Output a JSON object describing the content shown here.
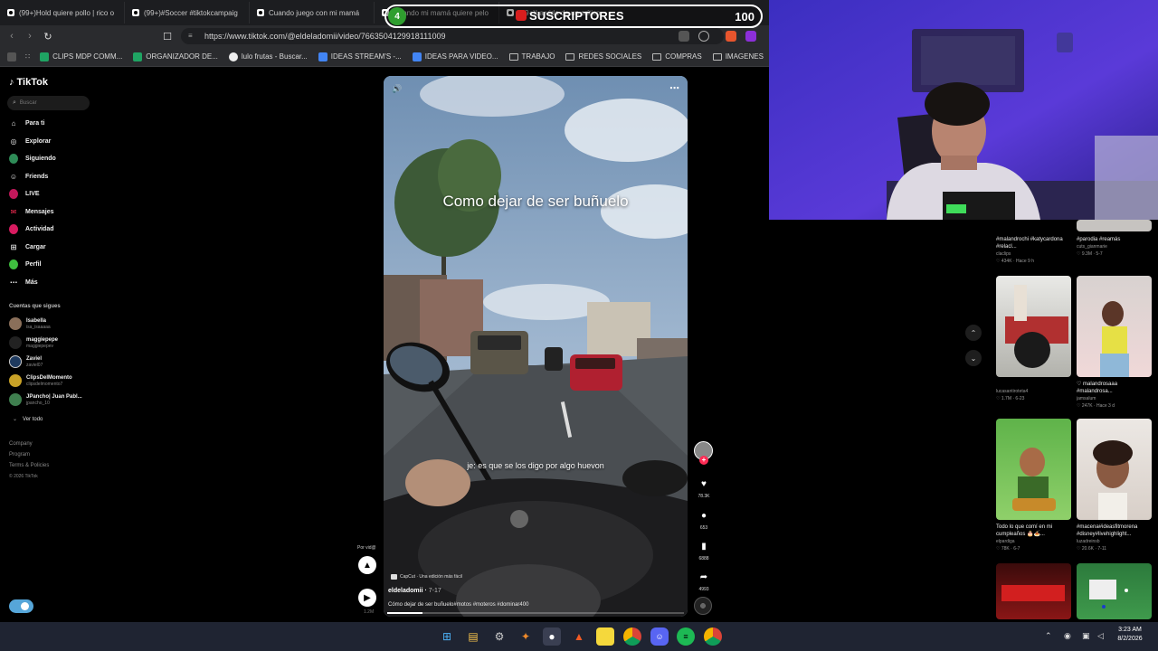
{
  "browser": {
    "tabs": [
      {
        "label": "(99+)Hold quiere pollo | rico o",
        "icon": "tiktok"
      },
      {
        "label": "(99+)#Soccer #tiktokcampaig",
        "icon": "tiktok"
      },
      {
        "label": "Cuando juego con mi mamá",
        "icon": "tiktok"
      },
      {
        "label": "Cuando mi mamá quiere pelo",
        "icon": "tiktok"
      },
      {
        "label": "(99+)La vida de un crítico",
        "icon": "tiktok"
      }
    ],
    "url": "https://www.tiktok.com/@eldeladomii/video/7663504129918111009",
    "bookmarks": [
      {
        "label": "CLIPS MDP COMM...",
        "color": "#1fa463"
      },
      {
        "label": "ORGANIZADOR DE...",
        "color": "#1fa463"
      },
      {
        "label": "lulo frutas - Buscar...",
        "color": "#e9e9e9"
      },
      {
        "label": "IDEAS STREAM'S -...",
        "color": "#4285f4"
      },
      {
        "label": "IDEAS PARA VIDEO...",
        "color": "#4285f4"
      },
      {
        "label": "TRABAJO",
        "color": "folder"
      },
      {
        "label": "REDES SOCIALES",
        "color": "folder"
      },
      {
        "label": "COMPRAS",
        "color": "folder"
      },
      {
        "label": "IMAGENES",
        "color": "folder"
      }
    ]
  },
  "overlay": {
    "subs_title": "SUSCRIPTORES",
    "subs_left": "4",
    "subs_right": "100"
  },
  "tiktok": {
    "logo": "TikTok",
    "search_placeholder": "Buscar",
    "nav": [
      {
        "label": "Para ti",
        "icon": "home-icon"
      },
      {
        "label": "Explorar",
        "icon": "compass-icon"
      },
      {
        "label": "Siguiendo",
        "icon": "following-icon"
      },
      {
        "label": "Friends",
        "icon": "friends-icon"
      },
      {
        "label": "LIVE",
        "icon": "live-icon"
      },
      {
        "label": "Mensajes",
        "icon": "messages-icon"
      },
      {
        "label": "Actividad",
        "icon": "activity-icon"
      },
      {
        "label": "Cargar",
        "icon": "upload-icon"
      },
      {
        "label": "Perfil",
        "icon": "profile-icon"
      },
      {
        "label": "Más",
        "icon": "more-icon"
      }
    ],
    "following_title": "Cuentas que sigues",
    "following": [
      {
        "name": "Isabella",
        "handle": "isa_isaaaaa"
      },
      {
        "name": "maggiepepe",
        "handle": "maggiepepev"
      },
      {
        "name": "Zaviel",
        "handle": "zaviel07"
      },
      {
        "name": "ClipsDelMomento",
        "handle": "clipsdelmomento7"
      },
      {
        "name": "JPancho| Juan Pabl...",
        "handle": "jpancho_10"
      }
    ],
    "see_all": "Ver todo",
    "footer": [
      "Company",
      "Program",
      "Terms & Policies",
      "© 2026 TikTok"
    ]
  },
  "video": {
    "caption": "Como dejar de ser buñuelo",
    "subtitle": "je: es que se los digo por algo huevon",
    "author": "eldeladomii",
    "date": "7-17",
    "description": "Cómo dejar de ser buñuelo#motos #moteros #dominar400",
    "capcut": "CapCut · Una edición más fácil",
    "progress": 0.12,
    "actions": [
      {
        "name": "like",
        "count": "78.3K"
      },
      {
        "name": "comment",
        "count": "653"
      },
      {
        "name": "save",
        "count": "6888"
      },
      {
        "name": "share",
        "count": "4993"
      }
    ],
    "repost_label": "Por vid@",
    "play_count": "1.2M"
  },
  "recommended": [
    {
      "caption": "#malandrochi #katycardona #relacl...",
      "user": "claclips",
      "stats": "434K · Hace 9 h"
    },
    {
      "caption": "#parodia #reamás",
      "user": "cuts_gianmarie",
      "stats": "9.3M · 5-7"
    },
    {
      "caption": "",
      "user": "lucasantiroteta4",
      "stats": "1.7M · 6-23"
    },
    {
      "caption": "♡ malandrosaaa #malandrosa...",
      "user": "jamsalum",
      "stats": "247K · Hace 3 d"
    },
    {
      "caption": "Todo lo que comí en mi cumpleaños 🎂🍝...",
      "user": "elpardiga",
      "stats": "78K · 6-7"
    },
    {
      "caption": "#macena#ideasfitmorena #disney#livehighlight...",
      "user": "luzadreinsb",
      "stats": "20.6K · 7-11"
    }
  ],
  "taskbar": {
    "time": "3:23 AM",
    "date": "8/2/2026"
  }
}
